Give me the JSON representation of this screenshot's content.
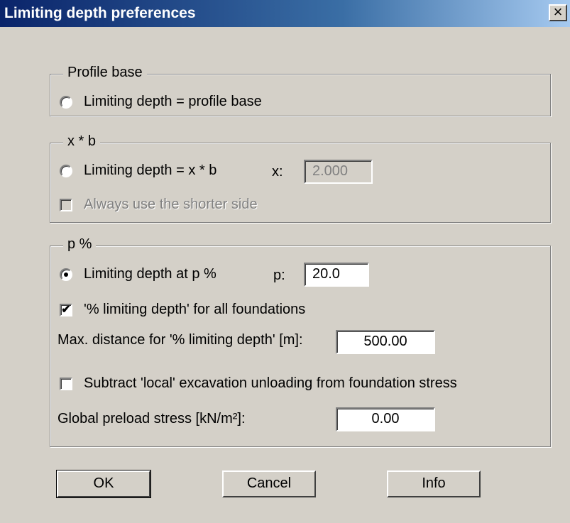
{
  "window": {
    "title": "Limiting depth preferences",
    "close_glyph": "×"
  },
  "profile_base": {
    "legend": "Profile base",
    "radio_label": "Limiting depth = profile base",
    "checked": false
  },
  "xb": {
    "legend": "x * b",
    "radio_label": "Limiting depth = x * b",
    "checked": false,
    "x_label": "x:",
    "x_value": "2.000",
    "shorter_side_label": "Always use the shorter side",
    "shorter_side_checked": false
  },
  "p_percent": {
    "legend": "p %",
    "radio_label": "Limiting depth at p %",
    "checked": true,
    "p_label": "p:",
    "p_value": "20.0",
    "all_foundations_label": "'% limiting depth' for all foundations",
    "all_foundations_checked": true,
    "check_glyph": "✔",
    "max_distance_label": "Max. distance for '% limiting depth' [m]:",
    "max_distance_value": "500.00",
    "subtract_label": "Subtract 'local' excavation unloading from foundation stress",
    "subtract_checked": false,
    "preload_label": "Global preload stress [kN/m²]:",
    "preload_value": "0.00"
  },
  "buttons": {
    "ok": "OK",
    "cancel": "Cancel",
    "info": "Info"
  }
}
